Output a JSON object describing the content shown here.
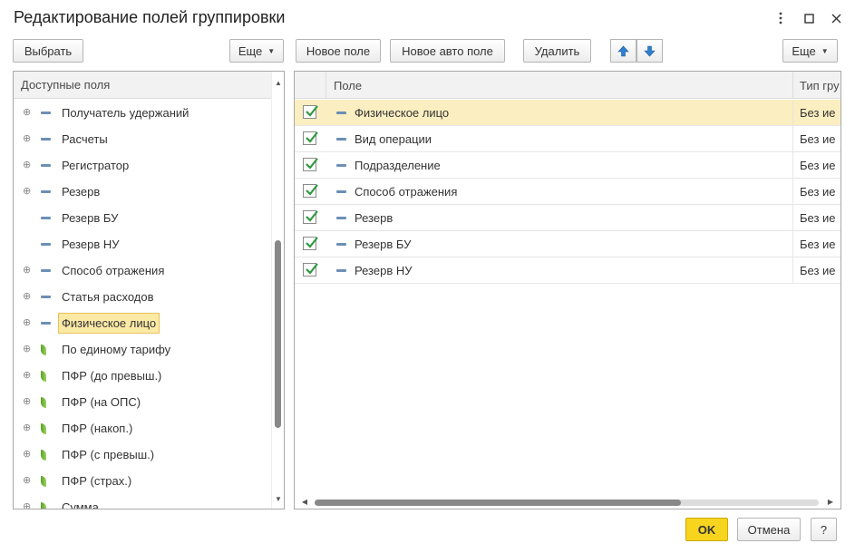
{
  "window": {
    "title": "Редактирование полей группировки"
  },
  "left_toolbar": {
    "select_label": "Выбрать",
    "more_label": "Еще"
  },
  "right_toolbar": {
    "new_field_label": "Новое поле",
    "new_auto_field_label": "Новое авто поле",
    "delete_label": "Удалить",
    "more_label": "Еще"
  },
  "available_fields": {
    "header": "Доступные поля",
    "items": [
      {
        "label": "Получатель удержаний",
        "icon": "dash",
        "expandable": true
      },
      {
        "label": "Расчеты",
        "icon": "dash",
        "expandable": true
      },
      {
        "label": "Регистратор",
        "icon": "dash",
        "expandable": true
      },
      {
        "label": "Резерв",
        "icon": "dash",
        "expandable": true
      },
      {
        "label": "Резерв БУ",
        "icon": "dash",
        "expandable": false
      },
      {
        "label": "Резерв НУ",
        "icon": "dash",
        "expandable": false
      },
      {
        "label": "Способ отражения",
        "icon": "dash",
        "expandable": true
      },
      {
        "label": "Статья расходов",
        "icon": "dash",
        "expandable": true
      },
      {
        "label": "Физическое лицо",
        "icon": "dash",
        "expandable": true,
        "selected": true
      },
      {
        "label": "По единому тарифу",
        "icon": "leaf",
        "expandable": true
      },
      {
        "label": "ПФР (до превыш.)",
        "icon": "leaf",
        "expandable": true
      },
      {
        "label": "ПФР (на ОПС)",
        "icon": "leaf",
        "expandable": true
      },
      {
        "label": "ПФР (накоп.)",
        "icon": "leaf",
        "expandable": true
      },
      {
        "label": "ПФР (с превыш.)",
        "icon": "leaf",
        "expandable": true
      },
      {
        "label": "ПФР (страх.)",
        "icon": "leaf",
        "expandable": true
      },
      {
        "label": "Сумма",
        "icon": "leaf",
        "expandable": true
      }
    ]
  },
  "grouping_fields": {
    "columns": {
      "field": "Поле",
      "type": "Тип гру"
    },
    "rows": [
      {
        "checked": true,
        "field": "Физическое лицо",
        "type": "Без ие",
        "selected": true
      },
      {
        "checked": true,
        "field": "Вид операции",
        "type": "Без ие"
      },
      {
        "checked": true,
        "field": "Подразделение",
        "type": "Без ие"
      },
      {
        "checked": true,
        "field": "Способ отражения",
        "type": "Без ие"
      },
      {
        "checked": true,
        "field": "Резерв",
        "type": "Без ие"
      },
      {
        "checked": true,
        "field": "Резерв БУ",
        "type": "Без ие"
      },
      {
        "checked": true,
        "field": "Резерв НУ",
        "type": "Без ие"
      }
    ]
  },
  "footer": {
    "ok_label": "OK",
    "cancel_label": "Отмена",
    "help_label": "?"
  },
  "colors": {
    "accent_yellow": "#f7d51e",
    "selection": "#fbe9a6",
    "check_green": "#2e9a3e",
    "arrow_blue": "#2f7fd0"
  }
}
